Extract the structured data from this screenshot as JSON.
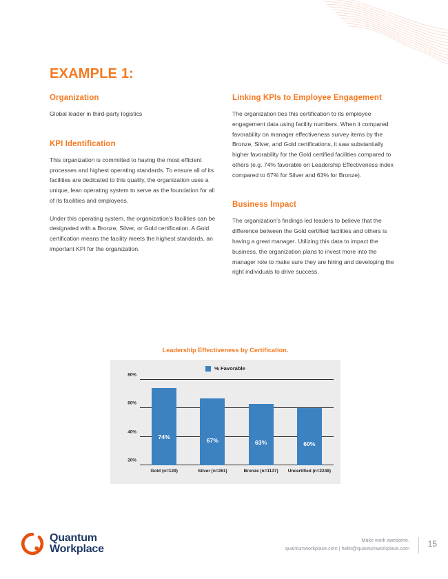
{
  "page_title": "EXAMPLE 1:",
  "left_column": {
    "organization_heading": "Organization",
    "organization_text": "Global leader in third-party logistics",
    "kpi_heading": "KPI Identification",
    "kpi_paragraph_1": "This organization is committed to having the most efficient processes and highest operating standards. To ensure all of its facilities are dedicated to this quality, the organization uses a unique, lean operating system to serve as the foundation for all of its facilities and employees.",
    "kpi_paragraph_2": "Under this operating system, the organization’s facilities can be designated with a Bronze, Silver, or Gold certification. A Gold certification means the facility meets the highest standards, an important KPI for the organization."
  },
  "right_column": {
    "linking_heading": "Linking KPIs to Employee Engagement",
    "linking_text": "The organization ties this certification to its employee engagement data using facility numbers. When it compared favorability on manager effectiveness survey items by the Bronze, Silver, and Gold certifications, it saw substantially higher favorability for the Gold certified facilities compared to others (e.g. 74% favorable on Leadership Effectiveness index compared to 67% for Silver and 63% for Bronze).",
    "business_impact_heading": "Business Impact",
    "business_impact_text": "The organization’s findings led leaders to believe that the difference between the Gold certified facilities and others is having a great manager. Utilizing this data to impact the business, the organization plans to invest more into the manager role to make sure they are hiring and developing the right individuals to drive success."
  },
  "chart_data": {
    "type": "bar",
    "title": "Leadership Effectiveness by Certification.",
    "categories": [
      "Gold (n=129)",
      "Silver (n=261)",
      "Bronze (n=1137)",
      "Uncertified (n=2248)"
    ],
    "values": [
      74,
      67,
      63,
      60
    ],
    "value_labels": [
      "74%",
      "67%",
      "63%",
      "60%"
    ],
    "series": [
      {
        "name": "% Favorable",
        "values": [
          74,
          67,
          63,
          60
        ]
      }
    ],
    "legend": [
      "% Favorable"
    ],
    "legend_position": "top-center",
    "xlabel": "",
    "ylabel": "",
    "ylim": [
      20,
      80
    ],
    "yticks": [
      20,
      40,
      60,
      80
    ],
    "ytick_labels": [
      "20%",
      "40%",
      "60%",
      "80%"
    ],
    "grid": true,
    "bar_color": "#3C81C0",
    "panel_color": "#ECECEC",
    "title_color": "#F47920"
  },
  "footer": {
    "logo_line_1": "Quantum",
    "logo_line_2": "Workplace",
    "tagline": "Make work awesome.",
    "contact": "quantumworkplace.com | hello@quantumworkplace.com",
    "page_number": "15"
  },
  "colors": {
    "accent_orange": "#F47920",
    "bar_blue": "#3C81C0",
    "logo_navy": "#1F3864",
    "logo_orange": "#E8500F",
    "body_text": "#3C3C3C"
  }
}
